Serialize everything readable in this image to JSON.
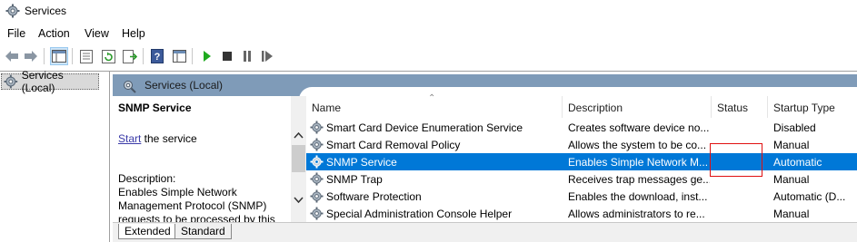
{
  "window": {
    "title": "Services",
    "icon": "gear-icon"
  },
  "menu": [
    "File",
    "Action",
    "View",
    "Help"
  ],
  "toolbar": {
    "buttons": [
      "back-arrow-icon",
      "forward-arrow-icon",
      "show-tree-icon",
      "properties-icon",
      "refresh-icon",
      "export-list-icon",
      "help-icon",
      "console-icon",
      "play-icon",
      "stop-icon",
      "pause-icon",
      "restart-icon"
    ]
  },
  "tree": {
    "root_label": "Services (Local)"
  },
  "header": {
    "title": "Services (Local)"
  },
  "details": {
    "service_name": "SNMP Service",
    "start_link": "Start",
    "start_suffix": " the service",
    "description_label": "Description:",
    "description_text": "Enables Simple Network Management Protocol (SNMP) requests to be processed by this"
  },
  "columns": [
    "Name",
    "Description",
    "Status",
    "Startup Type"
  ],
  "rows": [
    {
      "name": "Smart Card Device Enumeration Service",
      "description": "Creates software device no...",
      "status": "",
      "startup": "Disabled"
    },
    {
      "name": "Smart Card Removal Policy",
      "description": "Allows the system to be co...",
      "status": "",
      "startup": "Manual"
    },
    {
      "name": "SNMP Service",
      "description": "Enables Simple Network M...",
      "status": "",
      "startup": "Automatic",
      "selected": true
    },
    {
      "name": "SNMP Trap",
      "description": "Receives trap messages ge...",
      "status": "",
      "startup": "Manual"
    },
    {
      "name": "Software Protection",
      "description": "Enables the download, inst...",
      "status": "",
      "startup": "Automatic (D..."
    },
    {
      "name": "Special Administration Console Helper",
      "description": "Allows administrators to re...",
      "status": "",
      "startup": "Manual"
    }
  ],
  "tabs": [
    "Extended",
    "Standard"
  ],
  "colors": {
    "selection": "#0078d7",
    "header_band": "#7f9bb8",
    "highlight_box": "#e01010"
  }
}
